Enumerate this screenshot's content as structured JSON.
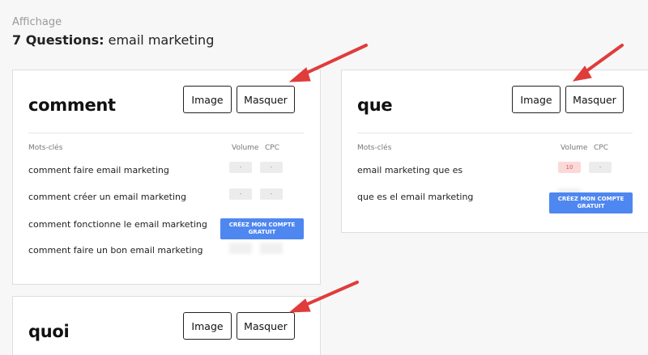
{
  "header": {
    "section_label": "Affichage",
    "count_label": "7 Questions:",
    "topic": "email marketing"
  },
  "buttons": {
    "image": "Image",
    "hide": "Masquer"
  },
  "table_headers": {
    "keywords": "Mots-clés",
    "volume": "Volume",
    "cpc": "CPC"
  },
  "cta_label": "CRÉEZ MON COMPTE GRATUIT",
  "cards": {
    "comment": {
      "title": "comment",
      "rows": [
        {
          "keyword": "comment faire email marketing",
          "volume": "-",
          "cpc": "-"
        },
        {
          "keyword": "comment créer un email marketing",
          "volume": "-",
          "cpc": "-"
        },
        {
          "keyword": "comment fonctionne le email marketing"
        },
        {
          "keyword": "comment faire un bon email marketing"
        }
      ]
    },
    "que": {
      "title": "que",
      "rows": [
        {
          "keyword": "email marketing que es",
          "volume": "10",
          "cpc": "-"
        },
        {
          "keyword": "que es el email marketing"
        }
      ]
    },
    "quoi": {
      "title": "quoi"
    }
  },
  "colors": {
    "cta": "#4f87f0",
    "arrow": "#e03c3c",
    "volume_highlight": "#fbd9d9"
  }
}
